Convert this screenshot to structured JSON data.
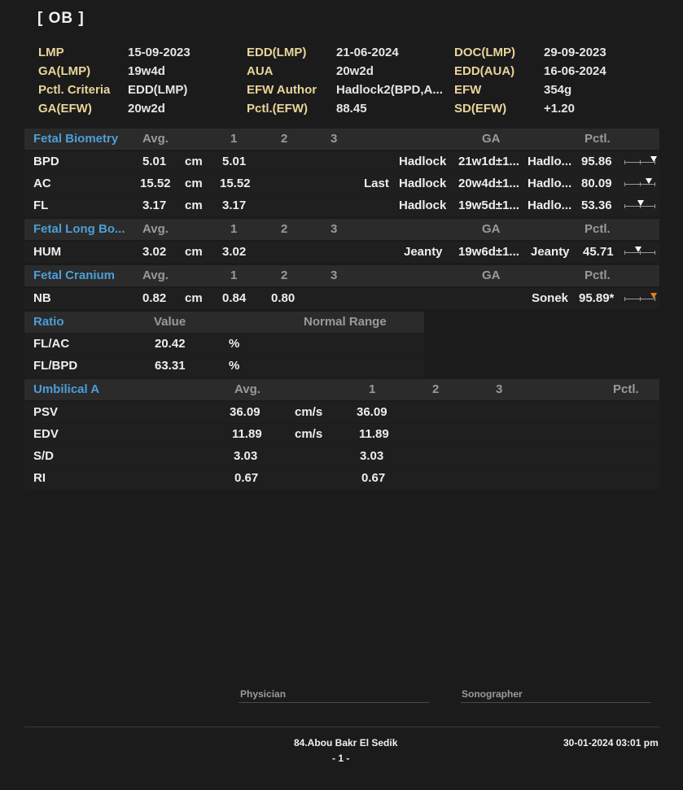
{
  "title": "[ OB ]",
  "header": {
    "lmp_k": "LMP",
    "lmp_v": "15-09-2023",
    "edd_lmp_k": "EDD(LMP)",
    "edd_lmp_v": "21-06-2024",
    "doc_lmp_k": "DOC(LMP)",
    "doc_lmp_v": "29-09-2023",
    "ga_lmp_k": "GA(LMP)",
    "ga_lmp_v": "19w4d",
    "aua_k": "AUA",
    "aua_v": "20w2d",
    "edd_aua_k": "EDD(AUA)",
    "edd_aua_v": "16-06-2024",
    "pctl_crit_k": "Pctl. Criteria",
    "pctl_crit_v": "EDD(LMP)",
    "efw_author_k": "EFW Author",
    "efw_author_v": "Hadlock2(BPD,A...",
    "efw_k": "EFW",
    "efw_v": "354g",
    "ga_efw_k": "GA(EFW)",
    "ga_efw_v": "20w2d",
    "pctl_efw_k": "Pctl.(EFW)",
    "pctl_efw_v": "88.45",
    "sd_efw_k": "SD(EFW)",
    "sd_efw_v": "+1.20"
  },
  "biometry": {
    "section": "Fetal Biometry",
    "cols": {
      "avg": "Avg.",
      "c1": "1",
      "c2": "2",
      "c3": "3",
      "ga": "GA",
      "pctl": "Pctl."
    },
    "rows": [
      {
        "name": "BPD",
        "avg": "5.01",
        "unit": "cm",
        "v1": "5.01",
        "note": "",
        "author": "Hadlock",
        "ga": "21w1d±1...",
        "pauthor": "Hadlo...",
        "pctl": "95.86",
        "marker": 0.95
      },
      {
        "name": "AC",
        "avg": "15.52",
        "unit": "cm",
        "v1": "15.52",
        "note": "Last",
        "author": "Hadlock",
        "ga": "20w4d±1...",
        "pauthor": "Hadlo...",
        "pctl": "80.09",
        "marker": 0.8
      },
      {
        "name": "FL",
        "avg": "3.17",
        "unit": "cm",
        "v1": "3.17",
        "note": "",
        "author": "Hadlock",
        "ga": "19w5d±1...",
        "pauthor": "Hadlo...",
        "pctl": "53.36",
        "marker": 0.53
      }
    ]
  },
  "longbone": {
    "section": "Fetal  Long Bo...",
    "cols": {
      "avg": "Avg.",
      "c1": "1",
      "c2": "2",
      "c3": "3",
      "ga": "GA",
      "pctl": "Pctl."
    },
    "rows": [
      {
        "name": "HUM",
        "avg": "3.02",
        "unit": "cm",
        "v1": "3.02",
        "author": "Jeanty",
        "ga": "19w6d±1...",
        "pauthor": "Jeanty",
        "pctl": "45.71",
        "marker": 0.46
      }
    ]
  },
  "cranium": {
    "section": "Fetal Cranium",
    "cols": {
      "avg": "Avg.",
      "c1": "1",
      "c2": "2",
      "c3": "3",
      "ga": "GA",
      "pctl": "Pctl."
    },
    "rows": [
      {
        "name": "NB",
        "avg": "0.82",
        "unit": "cm",
        "v1": "0.84",
        "v2": "0.80",
        "pauthor": "Sonek",
        "pctl": "95.89*",
        "marker": 0.96
      }
    ]
  },
  "ratio": {
    "section": "Ratio",
    "cols": {
      "value": "Value",
      "range": "Normal Range"
    },
    "rows": [
      {
        "name": "FL/AC",
        "value": "20.42",
        "unit": "%"
      },
      {
        "name": "FL/BPD",
        "value": "63.31",
        "unit": "%"
      }
    ]
  },
  "umbilical": {
    "section": "Umbilical A",
    "cols": {
      "avg": "Avg.",
      "c1": "1",
      "c2": "2",
      "c3": "3",
      "pctl": "Pctl."
    },
    "rows": [
      {
        "name": "PSV",
        "avg": "36.09",
        "unit": "cm/s",
        "v1": "36.09"
      },
      {
        "name": "EDV",
        "avg": "11.89",
        "unit": "cm/s",
        "v1": "11.89"
      },
      {
        "name": "S/D",
        "avg": "3.03",
        "unit": "",
        "v1": "3.03"
      },
      {
        "name": "RI",
        "avg": "0.67",
        "unit": "",
        "v1": "0.67"
      }
    ]
  },
  "signatures": {
    "physician": "Physician",
    "sonographer": "Sonographer"
  },
  "footer": {
    "clinic": "84.Abou Bakr El Sedik",
    "page": "- 1 -",
    "datetime": "30-01-2024 03:01 pm"
  },
  "colors": {
    "section": "#4b9fd8",
    "header_key": "#e9d49a",
    "alert_marker": "#e67e22"
  }
}
